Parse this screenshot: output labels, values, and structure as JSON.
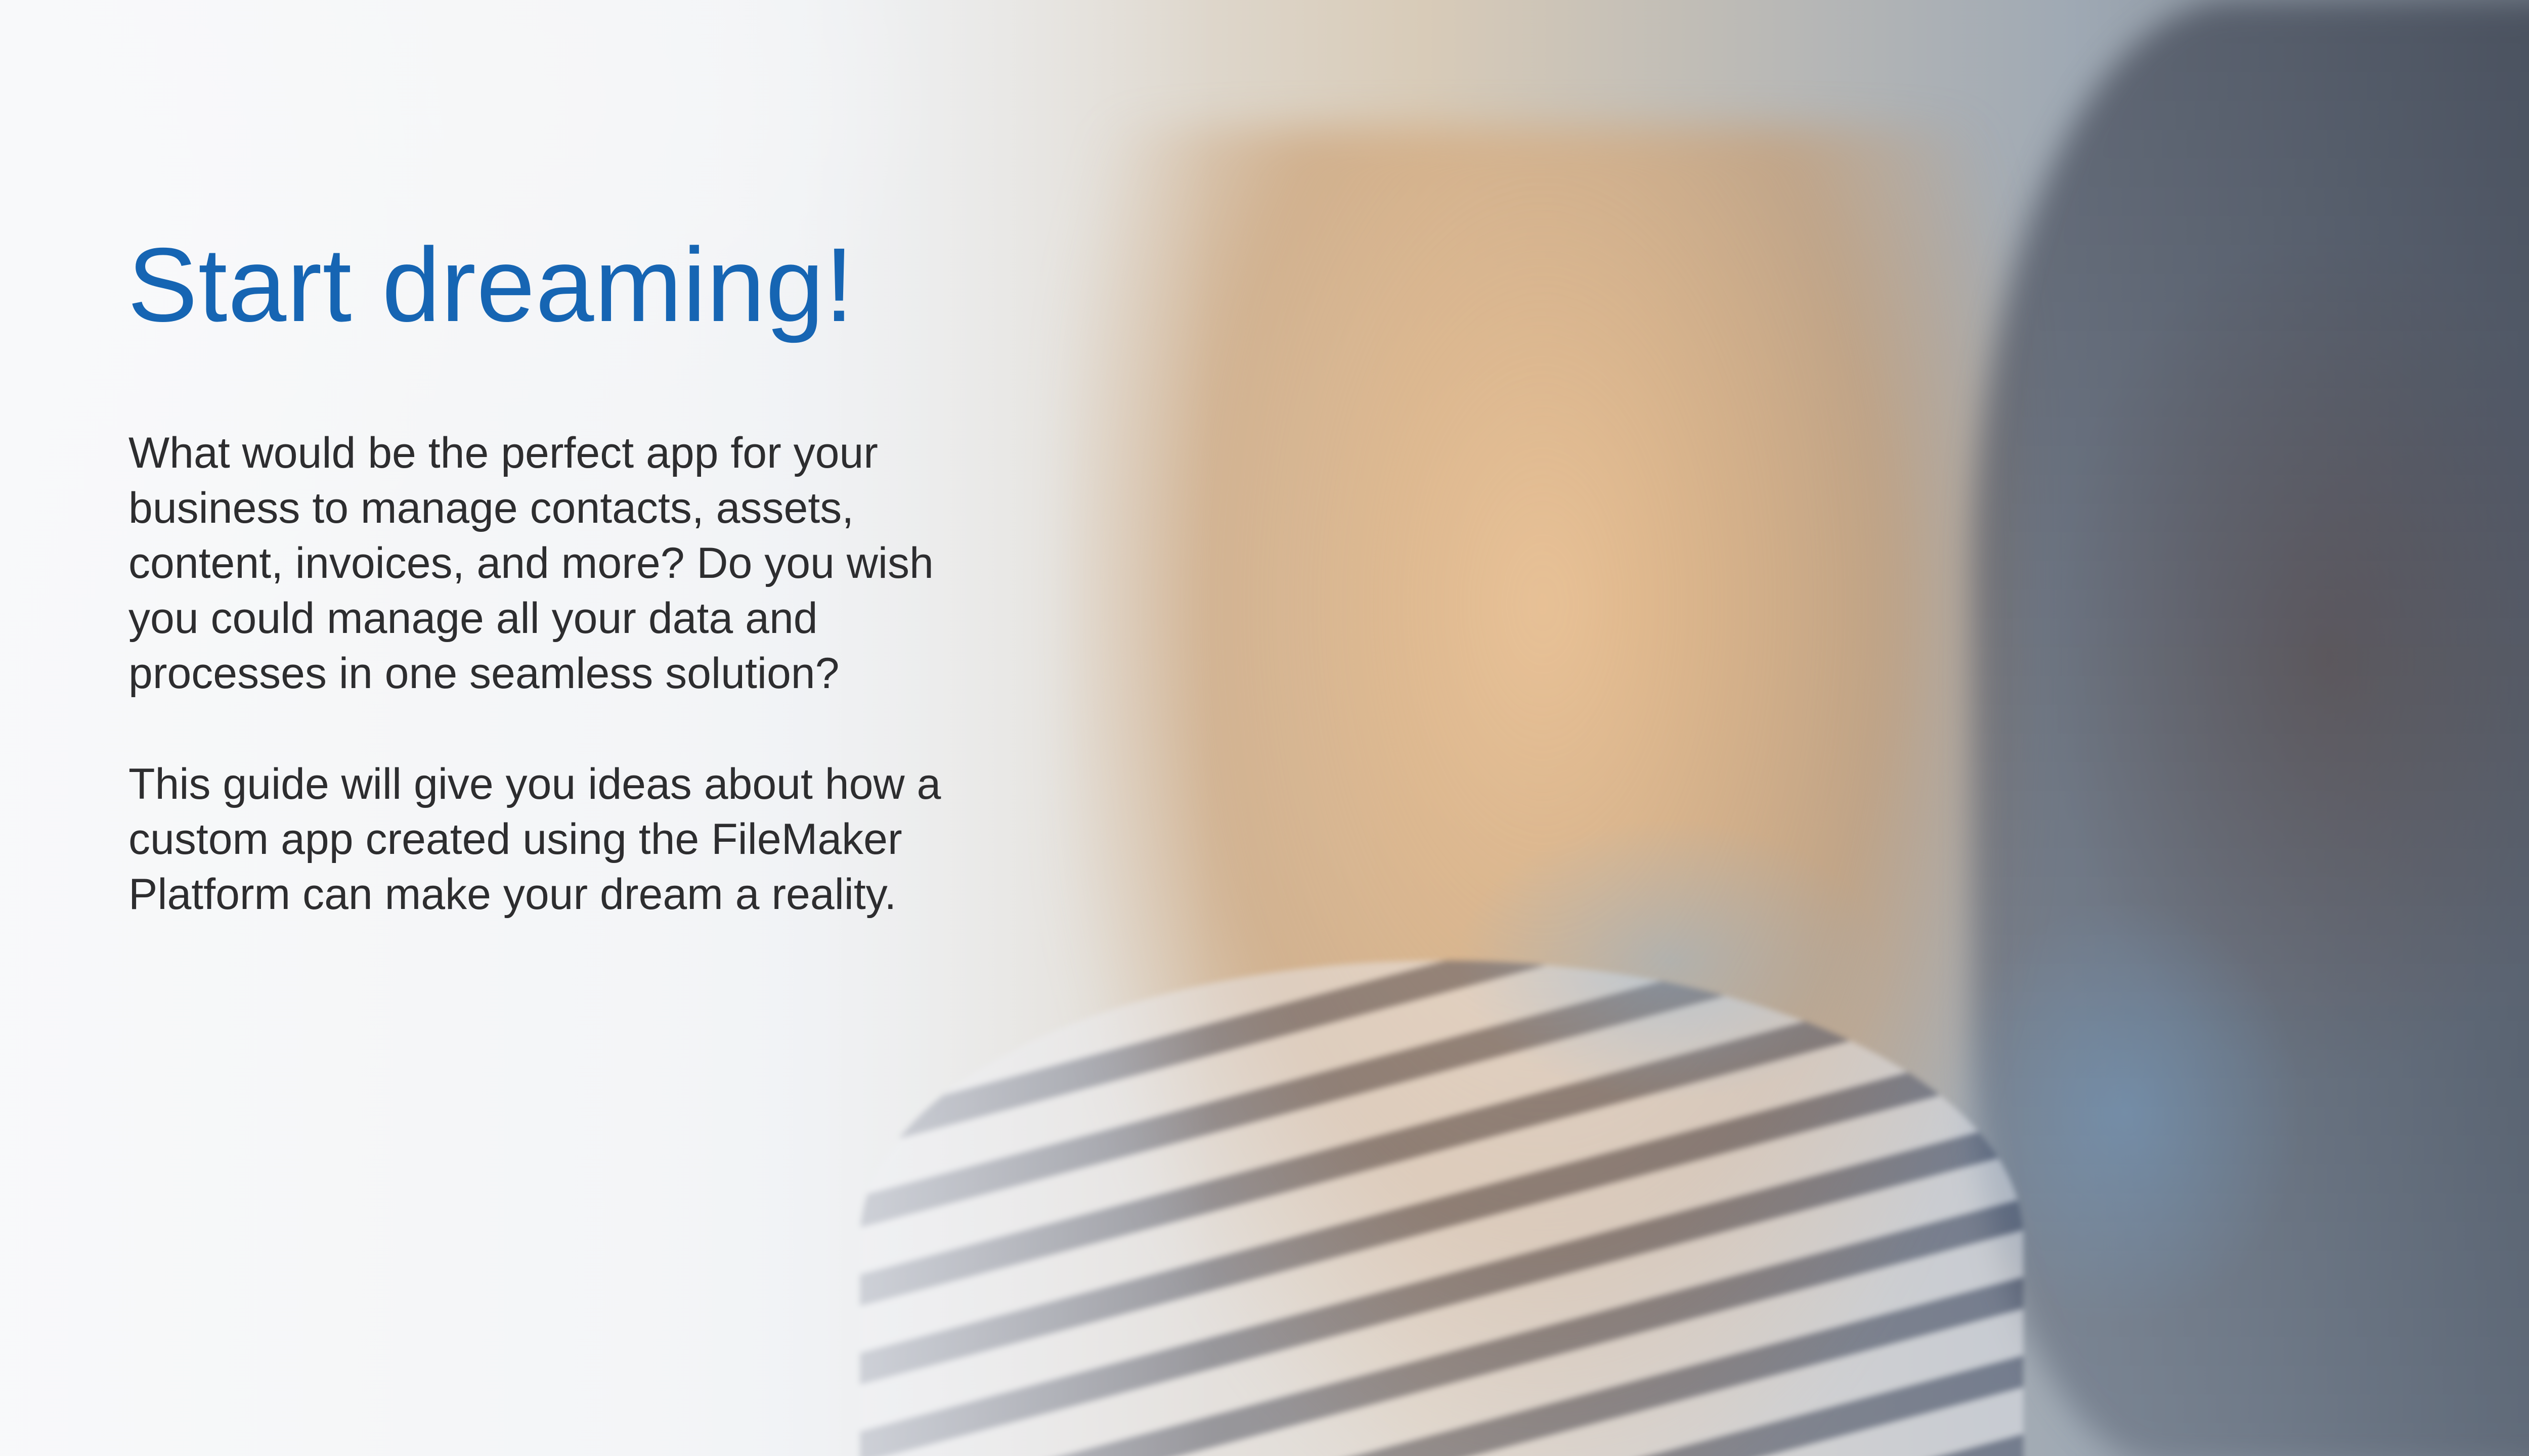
{
  "slide": {
    "title": "Start dreaming!",
    "paragraphs": [
      "What would be the perfect app for your business to manage contacts, assets, content, invoices, and more? Do you wish you could manage all your data and processes in one seamless solution?",
      "This guide will give you ideas about how a custom app created using the FileMaker Platform can make your dream a reality."
    ]
  },
  "colors": {
    "title": "#1665b3",
    "body_text": "#2d2d2f"
  }
}
